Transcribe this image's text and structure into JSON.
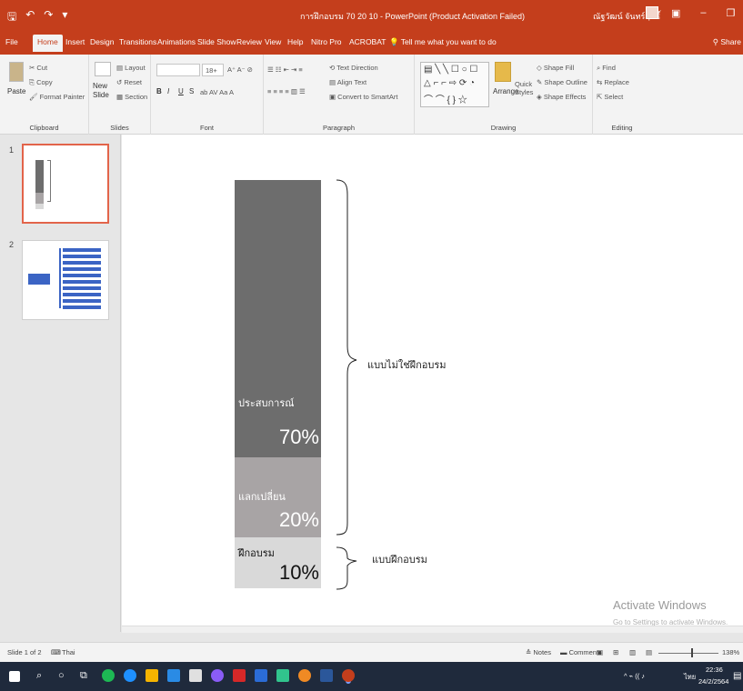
{
  "window": {
    "title": "การฝึกอบรม 70 20 10 - PowerPoint (Product Activation Failed)",
    "user": "ณัฐวัฒน์ จันทร์ฤทธิ์",
    "min": "–",
    "restore": "❐",
    "close": "✕"
  },
  "qat": {
    "save": "🖫",
    "undo": "↶",
    "redo": "↷",
    "more": "▾"
  },
  "tabs": [
    "File",
    "Home",
    "Insert",
    "Design",
    "Transitions",
    "Animations",
    "Slide Show",
    "Review",
    "View",
    "Help",
    "Nitro Pro",
    "ACROBAT"
  ],
  "active_tab": "Home",
  "tellme": "Tell me what you want to do",
  "share": "Share",
  "ribbon": {
    "clipboard": {
      "paste": "Paste",
      "cut": "Cut",
      "copy": "Copy",
      "format_painter": "Format Painter",
      "label": "Clipboard"
    },
    "slides": {
      "new_slide": "New Slide",
      "layout": "Layout",
      "reset": "Reset",
      "section": "Section",
      "label": "Slides"
    },
    "font": {
      "font_size": "18+",
      "bold": "B",
      "italic": "I",
      "underline": "U",
      "strike": "S",
      "label": "Font"
    },
    "paragraph": {
      "text_direction": "Text Direction",
      "align_text": "Align Text",
      "smartart": "Convert to SmartArt",
      "label": "Paragraph"
    },
    "drawing": {
      "arrange": "Arrange",
      "quick_styles": "Quick Styles",
      "shape_fill": "Shape Fill",
      "shape_outline": "Shape Outline",
      "shape_effects": "Shape Effects",
      "label": "Drawing"
    },
    "editing": {
      "find": "Find",
      "replace": "Replace",
      "select": "Select",
      "label": "Editing"
    }
  },
  "thumbnails": [
    {
      "num": "1"
    },
    {
      "num": "2"
    }
  ],
  "slide": {
    "segments": [
      {
        "label": "ประสบการณ์",
        "percent": "70%"
      },
      {
        "label": "แลกเปลี่ยน",
        "percent": "20%"
      },
      {
        "label": "ฝึกอบรม",
        "percent": "10%"
      }
    ],
    "brace_upper": "แบบไม่ใช่ฝึกอบรม",
    "brace_lower": "แบบฝึกอบรม"
  },
  "watermark": {
    "line1": "Activate Windows",
    "line2": "Go to Settings to activate Windows."
  },
  "status": {
    "slide_info": "Slide 1 of 2",
    "language": "Thai",
    "notes": "Notes",
    "comments": "Comments",
    "zoom": "138%"
  },
  "taskbar": {
    "time": "22:36",
    "date": "24/2/2564",
    "lang": "ไทย"
  },
  "colors": {
    "brand": "#c43e1c",
    "seg1": "#6d6d6d",
    "seg2": "#a8a4a5",
    "seg3": "#d9d9d9"
  }
}
